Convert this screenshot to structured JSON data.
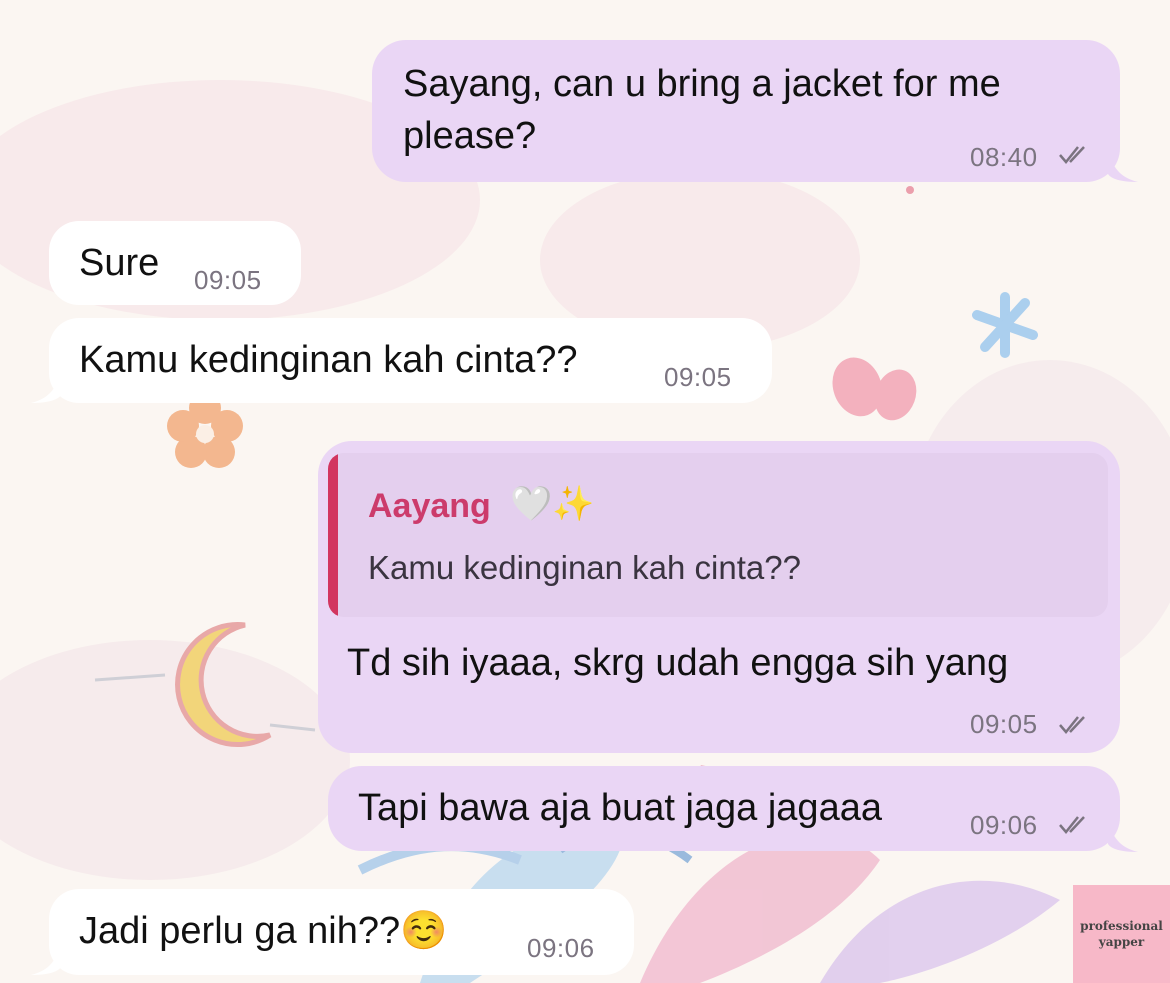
{
  "chat": {
    "messages": [
      {
        "direction": "outgoing",
        "text": "Sayang, can u bring a jacket for me\nplease?",
        "time": "08:40",
        "status": "read"
      },
      {
        "direction": "incoming",
        "text": "Sure",
        "time": "09:05"
      },
      {
        "direction": "incoming",
        "text": "Kamu kedinginan kah cinta??",
        "time": "09:05"
      },
      {
        "direction": "outgoing",
        "reply_to": {
          "author": "Aayang",
          "author_emoji": "🤍✨",
          "text": "Kamu kedinginan kah cinta??"
        },
        "text": "Td sih iyaaa, skrg udah engga sih yang",
        "time": "09:05",
        "status": "read"
      },
      {
        "direction": "outgoing",
        "text": "Tapi bawa aja buat jaga jagaaa",
        "time": "09:06",
        "status": "read"
      },
      {
        "direction": "incoming",
        "text": "Jadi perlu ga nih??",
        "emoji": "☺️",
        "time": "09:06"
      }
    ]
  },
  "watermark": {
    "line1": "professional",
    "line2": "yapper"
  },
  "colors": {
    "outgoing_bubble": "#ead6f5",
    "incoming_bubble": "#ffffff",
    "quote_accent": "#d2355f",
    "quote_author": "#cc3b6b",
    "timestamp": "#7b7480"
  },
  "icons": {
    "read_status": "double-check-icon"
  }
}
